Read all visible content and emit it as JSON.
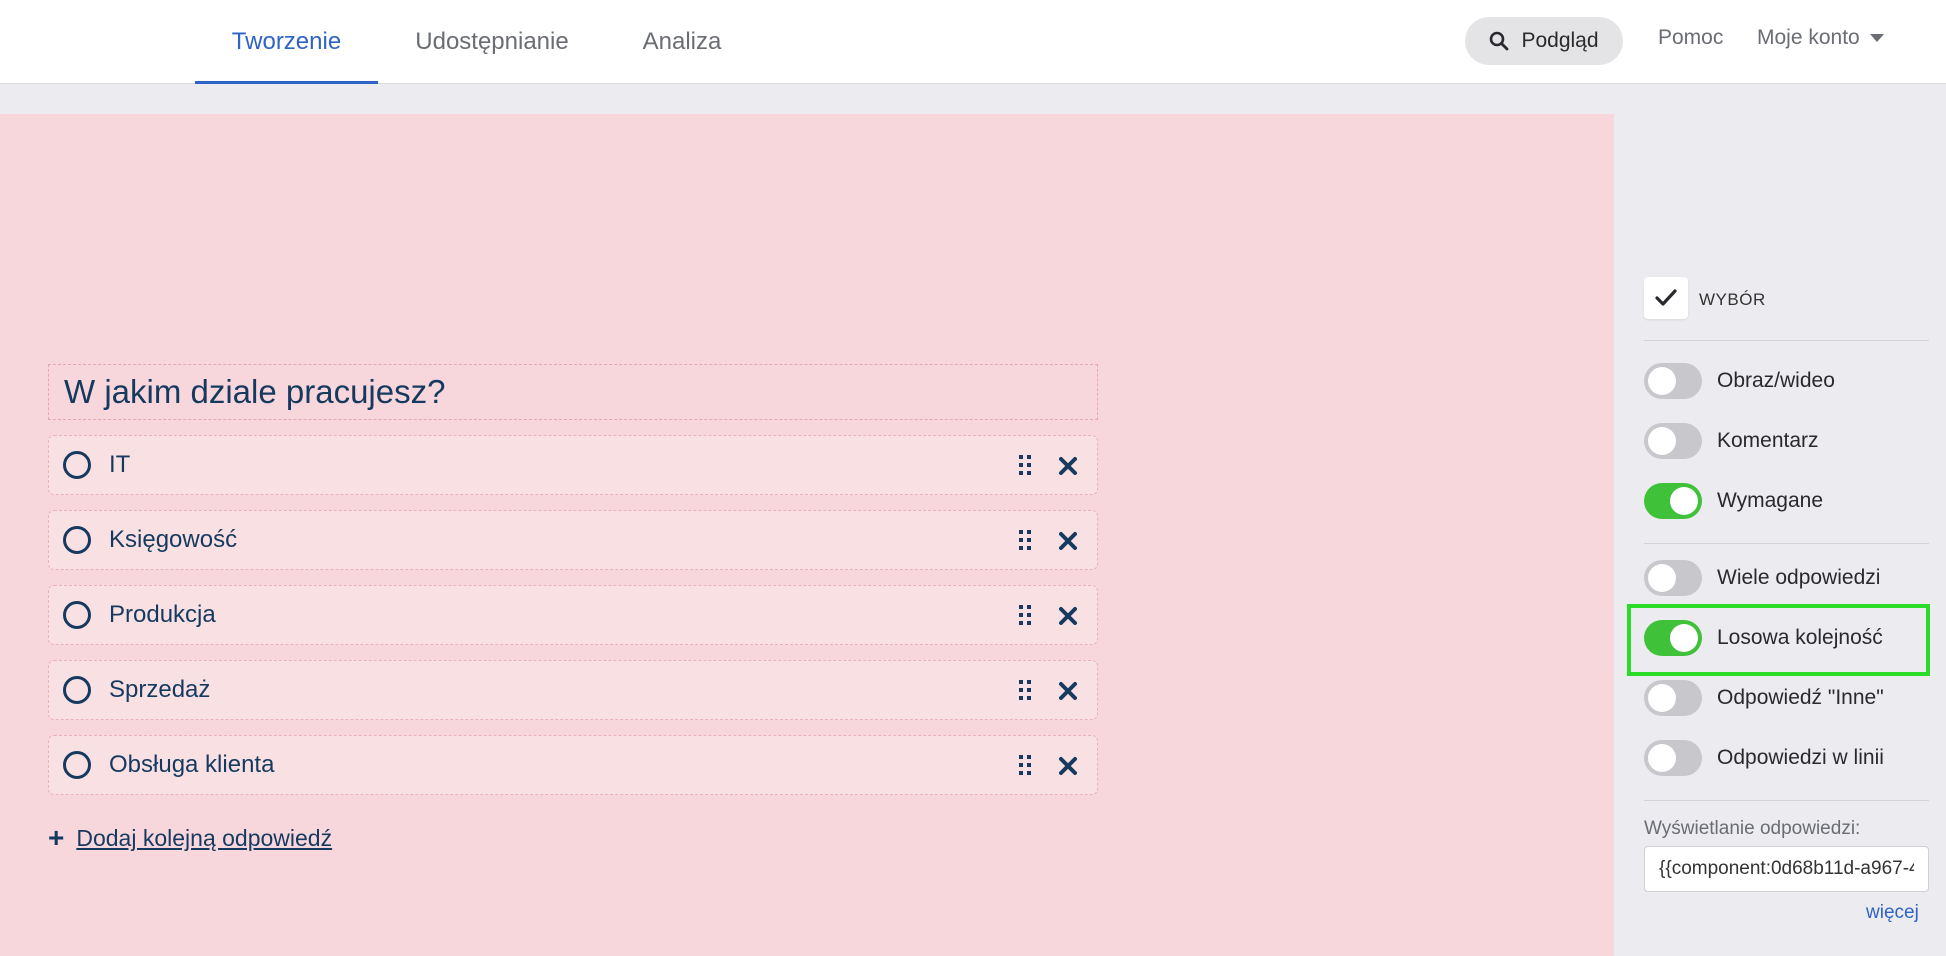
{
  "tabs": [
    {
      "label": "Tworzenie",
      "active": true
    },
    {
      "label": "Udostępnianie",
      "active": false
    },
    {
      "label": "Analiza",
      "active": false
    }
  ],
  "header": {
    "preview_label": "Podgląd",
    "help_label": "Pomoc",
    "account_label": "Moje konto"
  },
  "question": {
    "title": "W jakim dziale pracujesz?",
    "answers": [
      "IT",
      "Księgowość",
      "Produkcja",
      "Sprzedaż",
      "Obsługa klienta"
    ],
    "add_answer_label": "Dodaj kolejną odpowiedź"
  },
  "panel": {
    "type_label": "WYBÓR",
    "toggles": [
      {
        "label": "Obraz/wideo",
        "on": false
      },
      {
        "label": "Komentarz",
        "on": false
      },
      {
        "label": "Wymagane",
        "on": true
      },
      {
        "label": "Wiele odpowiedzi",
        "on": false
      },
      {
        "label": "Losowa kolejność",
        "on": true
      },
      {
        "label": "Odpowiedź \"Inne\"",
        "on": false
      },
      {
        "label": "Odpowiedzi w linii",
        "on": false
      }
    ],
    "display_label": "Wyświetlanie odpowiedzi:",
    "display_value": "{{component:0d68b11d-a967-4",
    "more_label": "więcej"
  },
  "colors": {
    "accent": "#2f63c7",
    "toggle_on": "#3fc23a",
    "canvas_bg": "#f8d7dc",
    "highlight": "#2adb2a"
  }
}
